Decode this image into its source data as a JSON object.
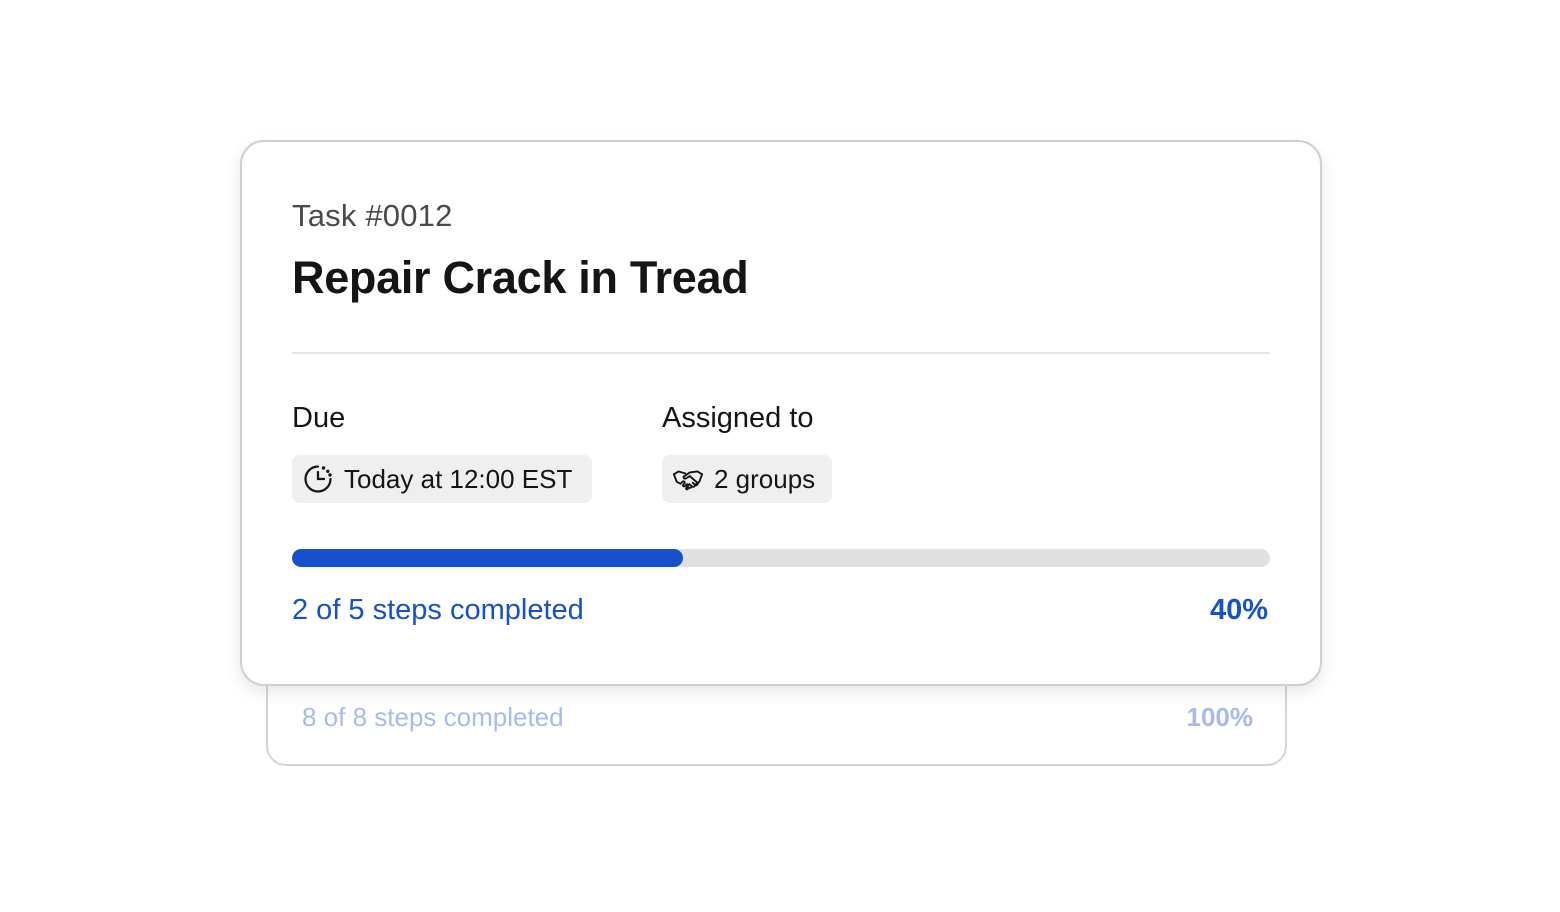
{
  "colors": {
    "accent": "#1650cc",
    "accent_faded": "#a8baea",
    "track": "#e0e0e0",
    "chip_bg": "#efefef",
    "text": "#151515",
    "muted_text": "#4a4a4a"
  },
  "back_card": {
    "steps_text": "8 of 8 steps completed",
    "percent_text": "100%",
    "progress_fraction": 1.0
  },
  "task": {
    "number": "Task #0012",
    "title": "Repair Crack in Tread",
    "due": {
      "label": "Due",
      "value": "Today at 12:00 EST",
      "icon": "clock-timer-icon"
    },
    "assigned": {
      "label": "Assigned to",
      "value": "2 groups",
      "icon": "handshake-icon"
    },
    "progress": {
      "completed_steps": 2,
      "total_steps": 5,
      "fraction": 0.4,
      "steps_text": "2 of 5 steps completed",
      "percent_text": "40%"
    }
  }
}
